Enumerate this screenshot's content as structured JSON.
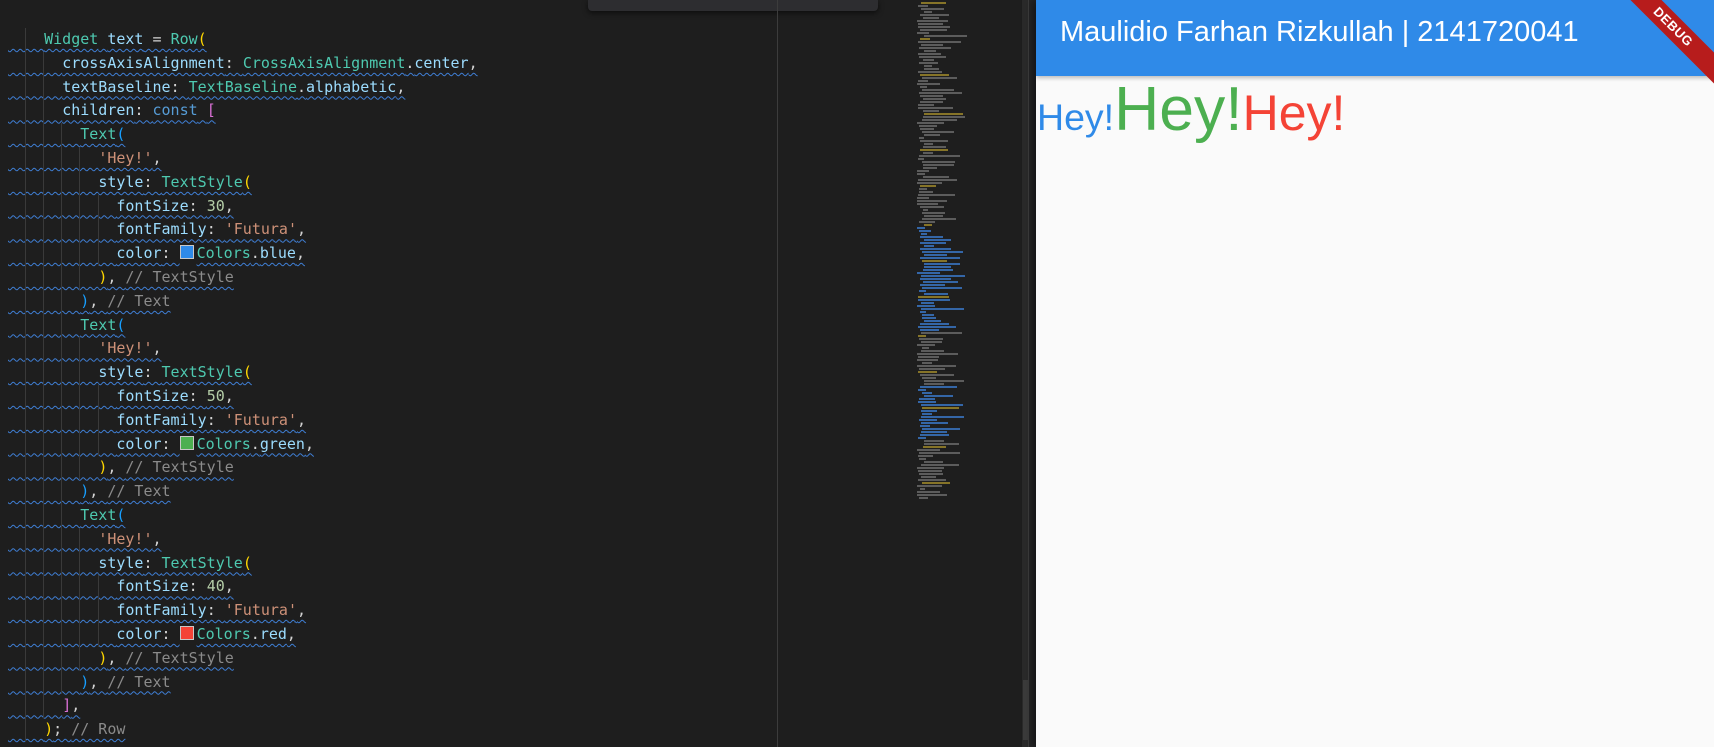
{
  "editor": {
    "lines": [
      {
        "indent": 2,
        "tokens": [
          [
            "t-type",
            "Widget"
          ],
          [
            "t-plain",
            " "
          ],
          [
            "t-var",
            "text"
          ],
          [
            "t-plain",
            " = "
          ],
          [
            "t-type",
            "Row"
          ],
          [
            "t-paren1",
            "("
          ]
        ]
      },
      {
        "indent": 3,
        "tokens": [
          [
            "t-var",
            "crossAxisAlignment"
          ],
          [
            "t-plain",
            ": "
          ],
          [
            "t-type",
            "CrossAxisAlignment"
          ],
          [
            "t-plain",
            "."
          ],
          [
            "t-var",
            "center"
          ],
          [
            "t-plain",
            ","
          ]
        ]
      },
      {
        "indent": 3,
        "tokens": [
          [
            "t-var",
            "textBaseline"
          ],
          [
            "t-plain",
            ": "
          ],
          [
            "t-type",
            "TextBaseline"
          ],
          [
            "t-plain",
            "."
          ],
          [
            "t-var",
            "alphabetic"
          ],
          [
            "t-plain",
            ","
          ]
        ]
      },
      {
        "indent": 3,
        "tokens": [
          [
            "t-var",
            "children"
          ],
          [
            "t-plain",
            ": "
          ],
          [
            "t-kw",
            "const"
          ],
          [
            "t-plain",
            " "
          ],
          [
            "t-paren2",
            "["
          ]
        ]
      },
      {
        "indent": 4,
        "tokens": [
          [
            "t-type",
            "Text"
          ],
          [
            "t-paren3",
            "("
          ]
        ]
      },
      {
        "indent": 5,
        "tokens": [
          [
            "t-str",
            "'Hey!'"
          ],
          [
            "t-plain",
            ","
          ]
        ]
      },
      {
        "indent": 5,
        "tokens": [
          [
            "t-var",
            "style"
          ],
          [
            "t-plain",
            ": "
          ],
          [
            "t-type",
            "TextStyle"
          ],
          [
            "t-paren1",
            "("
          ]
        ]
      },
      {
        "indent": 6,
        "tokens": [
          [
            "t-var",
            "fontSize"
          ],
          [
            "t-plain",
            ": "
          ],
          [
            "t-num",
            "30"
          ],
          [
            "t-plain",
            ","
          ]
        ]
      },
      {
        "indent": 6,
        "tokens": [
          [
            "t-var",
            "fontFamily"
          ],
          [
            "t-plain",
            ": "
          ],
          [
            "t-str",
            "'Futura'"
          ],
          [
            "t-plain",
            ","
          ]
        ]
      },
      {
        "indent": 6,
        "swatch": "#2f8ae8",
        "tokens": [
          [
            "t-var",
            "color"
          ],
          [
            "t-plain",
            ": "
          ],
          [
            "swatch",
            ""
          ],
          [
            "t-type",
            "Colors"
          ],
          [
            "t-plain",
            "."
          ],
          [
            "t-var",
            "blue"
          ],
          [
            "t-plain",
            ","
          ]
        ]
      },
      {
        "indent": 5,
        "tokens": [
          [
            "t-paren1",
            ")"
          ],
          [
            "t-plain",
            ", "
          ],
          [
            "t-cm",
            "// TextStyle"
          ]
        ]
      },
      {
        "indent": 4,
        "tokens": [
          [
            "t-paren3",
            ")"
          ],
          [
            "t-plain",
            ", "
          ],
          [
            "t-cm",
            "// Text"
          ]
        ]
      },
      {
        "indent": 4,
        "tokens": [
          [
            "t-type",
            "Text"
          ],
          [
            "t-paren3",
            "("
          ]
        ]
      },
      {
        "indent": 5,
        "tokens": [
          [
            "t-str",
            "'Hey!'"
          ],
          [
            "t-plain",
            ","
          ]
        ]
      },
      {
        "indent": 5,
        "tokens": [
          [
            "t-var",
            "style"
          ],
          [
            "t-plain",
            ": "
          ],
          [
            "t-type",
            "TextStyle"
          ],
          [
            "t-paren1",
            "("
          ]
        ]
      },
      {
        "indent": 6,
        "tokens": [
          [
            "t-var",
            "fontSize"
          ],
          [
            "t-plain",
            ": "
          ],
          [
            "t-num",
            "50"
          ],
          [
            "t-plain",
            ","
          ]
        ]
      },
      {
        "indent": 6,
        "tokens": [
          [
            "t-var",
            "fontFamily"
          ],
          [
            "t-plain",
            ": "
          ],
          [
            "t-str",
            "'Futura'"
          ],
          [
            "t-plain",
            ","
          ]
        ]
      },
      {
        "indent": 6,
        "swatch": "#4caf50",
        "tokens": [
          [
            "t-var",
            "color"
          ],
          [
            "t-plain",
            ": "
          ],
          [
            "swatch",
            ""
          ],
          [
            "t-type",
            "Colors"
          ],
          [
            "t-plain",
            "."
          ],
          [
            "t-var",
            "green"
          ],
          [
            "t-plain",
            ","
          ]
        ]
      },
      {
        "indent": 5,
        "tokens": [
          [
            "t-paren1",
            ")"
          ],
          [
            "t-plain",
            ", "
          ],
          [
            "t-cm",
            "// TextStyle"
          ]
        ]
      },
      {
        "indent": 4,
        "tokens": [
          [
            "t-paren3",
            ")"
          ],
          [
            "t-plain",
            ", "
          ],
          [
            "t-cm",
            "// Text"
          ]
        ]
      },
      {
        "indent": 4,
        "tokens": [
          [
            "t-type",
            "Text"
          ],
          [
            "t-paren3",
            "("
          ]
        ]
      },
      {
        "indent": 5,
        "tokens": [
          [
            "t-str",
            "'Hey!'"
          ],
          [
            "t-plain",
            ","
          ]
        ]
      },
      {
        "indent": 5,
        "tokens": [
          [
            "t-var",
            "style"
          ],
          [
            "t-plain",
            ": "
          ],
          [
            "t-type",
            "TextStyle"
          ],
          [
            "t-paren1",
            "("
          ]
        ]
      },
      {
        "indent": 6,
        "tokens": [
          [
            "t-var",
            "fontSize"
          ],
          [
            "t-plain",
            ": "
          ],
          [
            "t-num",
            "40"
          ],
          [
            "t-plain",
            ","
          ]
        ]
      },
      {
        "indent": 6,
        "tokens": [
          [
            "t-var",
            "fontFamily"
          ],
          [
            "t-plain",
            ": "
          ],
          [
            "t-str",
            "'Futura'"
          ],
          [
            "t-plain",
            ","
          ]
        ]
      },
      {
        "indent": 6,
        "swatch": "#f44336",
        "tokens": [
          [
            "t-var",
            "color"
          ],
          [
            "t-plain",
            ": "
          ],
          [
            "swatch",
            ""
          ],
          [
            "t-type",
            "Colors"
          ],
          [
            "t-plain",
            "."
          ],
          [
            "t-var",
            "red"
          ],
          [
            "t-plain",
            ","
          ]
        ]
      },
      {
        "indent": 5,
        "tokens": [
          [
            "t-paren1",
            ")"
          ],
          [
            "t-plain",
            ", "
          ],
          [
            "t-cm",
            "// TextStyle"
          ]
        ]
      },
      {
        "indent": 4,
        "tokens": [
          [
            "t-paren3",
            ")"
          ],
          [
            "t-plain",
            ", "
          ],
          [
            "t-cm",
            "// Text"
          ]
        ]
      },
      {
        "indent": 3,
        "tokens": [
          [
            "t-paren2",
            "]"
          ],
          [
            "t-plain",
            ","
          ]
        ]
      },
      {
        "indent": 2,
        "tokens": [
          [
            "t-paren1",
            ")"
          ],
          [
            "t-plain",
            "; "
          ],
          [
            "t-cm",
            "// Row"
          ]
        ]
      }
    ]
  },
  "app": {
    "title": "Maulidio Farhan Rizkullah | 2141720041",
    "banner": "DEBUG",
    "appbar_color": "#2f8ae8",
    "texts": [
      {
        "text": "Hey!",
        "font_size": 30,
        "color": "#2f8ae8"
      },
      {
        "text": "Hey!",
        "font_size": 50,
        "color": "#4caf50"
      },
      {
        "text": "Hey!",
        "font_size": 40,
        "color": "#f44336"
      }
    ]
  }
}
